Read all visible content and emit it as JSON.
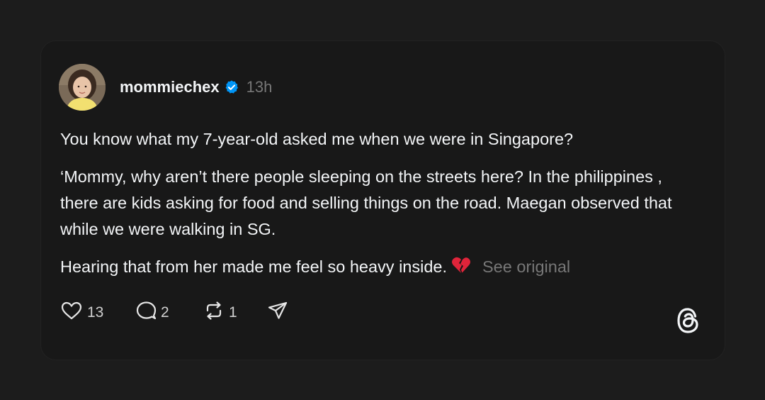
{
  "post": {
    "username": "mommiechex",
    "time": "13h",
    "paragraphs": [
      "You know what my 7-year-old asked me when we were in Singapore?",
      "‘Mommy, why aren’t there people sleeping on the streets here? In the philippines , there are kids asking for food and selling things on the road. Maegan observed that while we were walking in SG.",
      "Hearing that from her made me feel so heavy inside."
    ],
    "see_original": "See original",
    "emoji_icon": "broken-heart-icon"
  },
  "actions": {
    "likes": "13",
    "replies": "2",
    "reposts": "1"
  },
  "icons": {
    "verified": "verified-badge-icon",
    "like": "heart-icon",
    "reply": "comment-icon",
    "repost": "repost-icon",
    "share": "send-icon",
    "logo": "threads-logo-icon"
  },
  "colors": {
    "background": "#1c1c1c",
    "card": "#181818",
    "verified_blue": "#0095f6",
    "muted_text": "#777777",
    "broken_heart": "#e0243a"
  }
}
